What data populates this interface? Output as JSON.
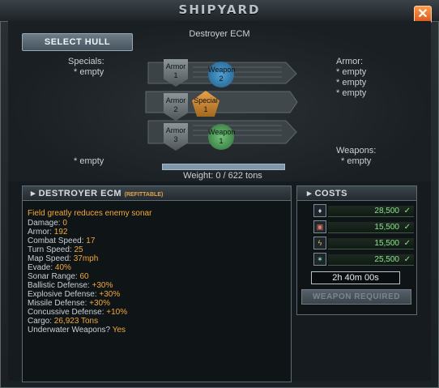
{
  "window": {
    "title": "SHIPYARD",
    "close_label": "✕"
  },
  "hull": {
    "select_label": "SELECT HULL",
    "name": "Destroyer ECM",
    "left": {
      "specials_label": "Specials:",
      "specials_value": "* empty",
      "weapons_value": "* empty"
    },
    "right": {
      "armor_label": "Armor:",
      "armor_values": [
        "* empty",
        "* empty",
        "* empty"
      ],
      "weapons_label": "Weapons:",
      "weapons_value": "* empty"
    },
    "slots": {
      "armor1": [
        "Armor",
        "1"
      ],
      "armor2": [
        "Armor",
        "2"
      ],
      "armor3": [
        "Armor",
        "3"
      ],
      "weapon2": [
        "Weapon",
        "2"
      ],
      "weapon1": [
        "Weapon",
        "1"
      ],
      "special1": [
        "Special",
        "1"
      ]
    },
    "weight_text": "Weight: 0 / 622 tons",
    "weight_fill": 0
  },
  "info": {
    "title": "DESTROYER ECM",
    "refit_tag": "(REFITTABLE)",
    "description": "Field greatly reduces enemy sonar",
    "stats": [
      [
        "Damage:",
        "0"
      ],
      [
        "Armor:",
        "192"
      ],
      [
        "Combat Speed:",
        "17"
      ],
      [
        "Turn Speed:",
        "25"
      ],
      [
        "Map Speed:",
        "37mph"
      ],
      [
        "Evade:",
        "40%"
      ],
      [
        "Sonar Range:",
        "60"
      ],
      [
        "Ballistic Defense:",
        "+30%"
      ],
      [
        "Explosive Defense:",
        "+30%"
      ],
      [
        "Missile Defense:",
        "+30%"
      ],
      [
        "Concussive Defense:",
        "+10%"
      ],
      [
        "Cargo:",
        "26,923 Tons"
      ],
      [
        "Underwater Weapons?",
        "Yes"
      ]
    ]
  },
  "costs": {
    "title": "COSTS",
    "resources": [
      {
        "icon": "oil-drop-icon",
        "value": "28,500"
      },
      {
        "icon": "steel-icon",
        "value": "15,500"
      },
      {
        "icon": "energy-bolt-icon",
        "value": "15,500"
      },
      {
        "icon": "crystal-icon",
        "value": "25,500"
      }
    ],
    "check": "✓",
    "time": "2h 40m 00s",
    "weapon_required_label": "WEAPON REQUIRED"
  },
  "colors": {
    "accent_orange": "#f2a93b",
    "ok_green": "#8be58b",
    "close_orange": "#e8692a"
  }
}
